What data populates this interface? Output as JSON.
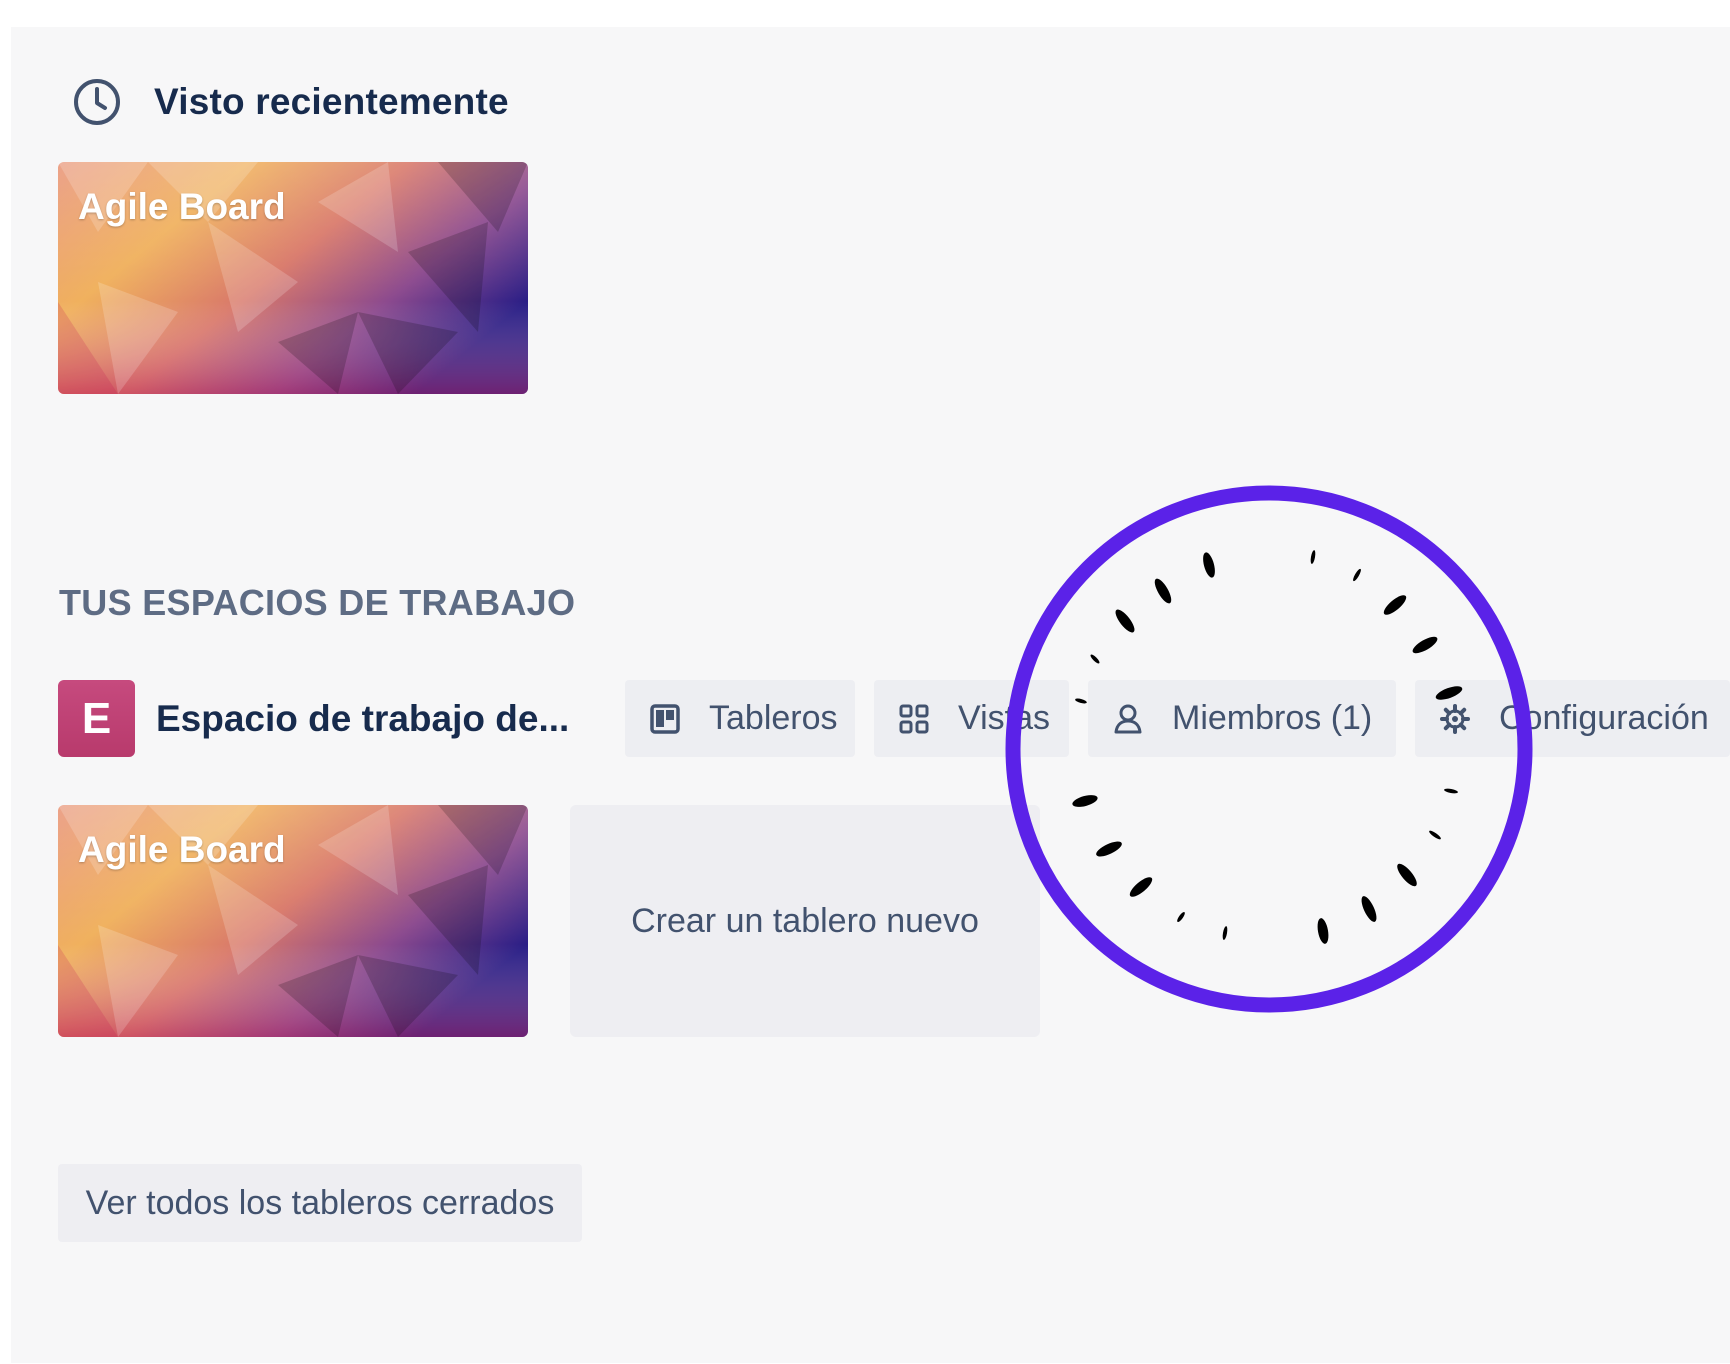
{
  "recent": {
    "heading": "Visto recientemente",
    "icon": "clock-icon",
    "boards": [
      {
        "title": "Agile Board"
      }
    ]
  },
  "workspaces": {
    "heading": "TUS ESPACIOS DE TRABAJO",
    "workspace": {
      "avatar_letter": "E",
      "avatar_color": "#c0447a",
      "name": "Espacio de trabajo de...",
      "actions": {
        "boards": {
          "label": "Tableros",
          "icon": "board-icon"
        },
        "views": {
          "label": "Vistas",
          "icon": "grid-icon"
        },
        "members": {
          "label": "Miembros (1)",
          "icon": "person-icon"
        },
        "settings": {
          "label": "Configuración",
          "icon": "gear-icon"
        }
      },
      "boards": [
        {
          "title": "Agile Board"
        }
      ],
      "create_board_label": "Crear un tablero nuevo"
    }
  },
  "closed_boards_label": "Ver todos los tableros cerrados",
  "annotation": {
    "color": "#5b22e8"
  }
}
